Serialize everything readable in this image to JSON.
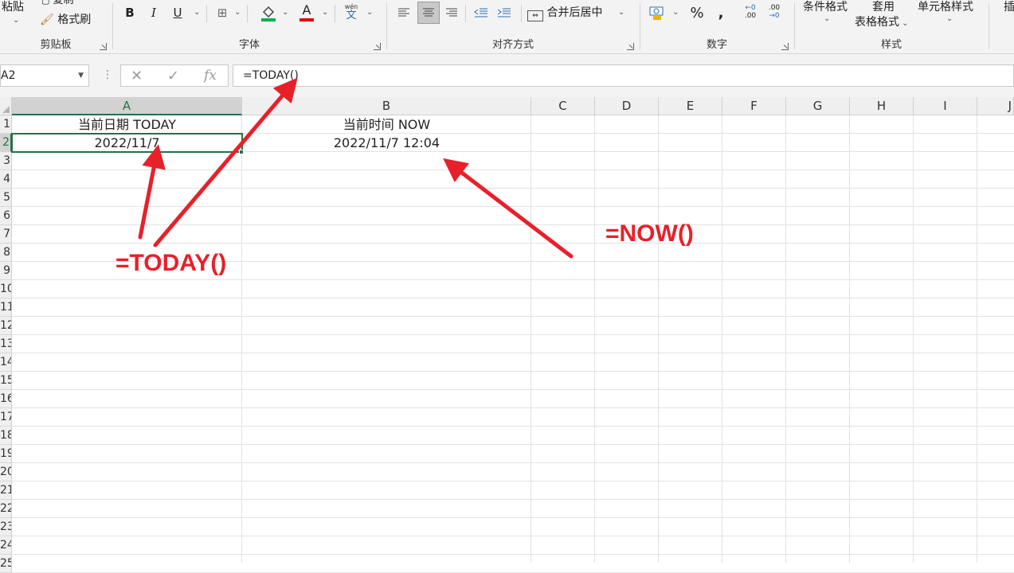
{
  "ribbon": {
    "clipboard": {
      "paste_label": "粘贴",
      "copy_label": "复制",
      "format_painter_label": "格式刷",
      "group_label": "剪贴板"
    },
    "font": {
      "bold": "B",
      "italic": "I",
      "underline": "U",
      "font_color_glyph": "A",
      "phonetic_top": "wén",
      "phonetic_bottom": "文",
      "group_label": "字体"
    },
    "alignment": {
      "merge_center_label": "合并后居中",
      "group_label": "对齐方式"
    },
    "number": {
      "percent": "%",
      "comma": ",",
      "inc_decimal_top": "←0",
      "inc_decimal_bottom": ".00",
      "dec_decimal_top": ".00",
      "dec_decimal_bottom": "→0",
      "group_label": "数字"
    },
    "styles": {
      "conditional_format_label": "条件格式",
      "format_as_table_line1": "套用",
      "format_as_table_line2": "表格格式",
      "cell_styles_label": "单元格样式",
      "group_label": "样式"
    },
    "insert_partial_label": "插",
    "colors": {
      "fill_color": "#00b050",
      "font_color": "#e00000"
    }
  },
  "formula_bar": {
    "name_box": "A2",
    "cancel_icon": "✕",
    "enter_icon": "✓",
    "fx_label": "fx",
    "formula": "=TODAY()"
  },
  "grid": {
    "columns": [
      "A",
      "B",
      "C",
      "D",
      "E",
      "F",
      "G",
      "H",
      "I",
      "J"
    ],
    "rows": [
      "1",
      "2",
      "3",
      "4",
      "5",
      "6",
      "7",
      "8",
      "9",
      "10",
      "11",
      "12",
      "13",
      "14",
      "15",
      "16",
      "17",
      "18",
      "19",
      "20",
      "21",
      "22",
      "23",
      "24",
      "25"
    ],
    "selected_cell": "A2",
    "cells": {
      "A1": "当前日期 TODAY",
      "B1": "当前时间 NOW",
      "A2": "2022/11/7",
      "B2": "2022/11/7 12:04"
    }
  },
  "annotations": {
    "today_label": "=TODAY()",
    "now_label": "=NOW()",
    "color": "#e8202a"
  }
}
